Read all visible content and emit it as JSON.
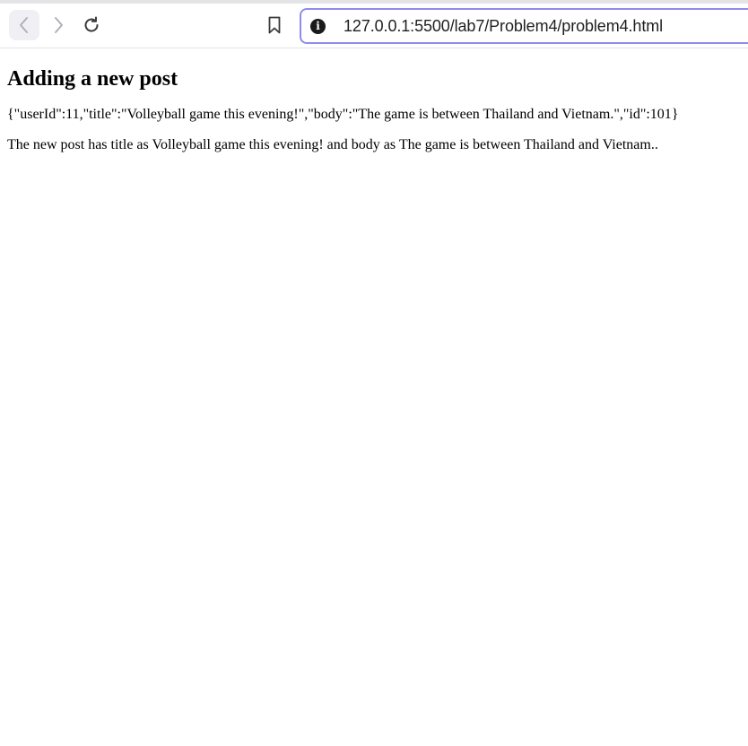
{
  "browser": {
    "url": "127.0.0.1:5500/lab7/Problem4/problem4.html",
    "site_info_glyph": "i",
    "icons": {
      "back": "chevron-left-icon",
      "forward": "chevron-right-icon",
      "reload": "reload-icon",
      "bookmark": "bookmark-icon",
      "site_info": "info-icon"
    },
    "accent_color": "#8f8cf0"
  },
  "page": {
    "heading": "Adding a new post",
    "json_response": "{\"userId\":11,\"title\":\"Volleyball game this evening!\",\"body\":\"The game is between Thailand and Vietnam.\",\"id\":101}",
    "summary": "The new post has title as Volleyball game this evening! and body as The game is between Thailand and Vietnam.."
  }
}
